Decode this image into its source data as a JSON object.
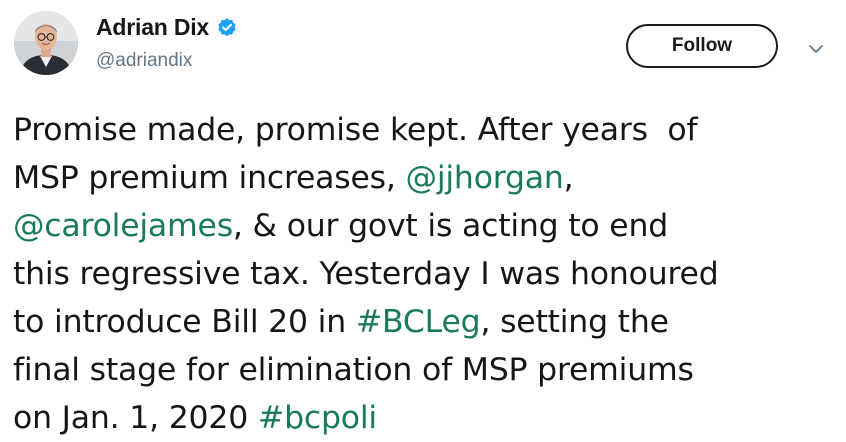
{
  "author": {
    "display_name": "Adrian Dix",
    "handle": "@adriandix",
    "verified_icon": "verified-badge-icon",
    "verified_color": "#1da1f2"
  },
  "actions": {
    "follow_label": "Follow",
    "more_icon": "chevron-down-icon"
  },
  "tweet": {
    "line1": "Promise made, promise kept. After years  of",
    "line2_text": "MSP premium increases, ",
    "line2_mention": "@jjhorgan",
    "line2_tail": ",",
    "line3_mention": "@carolejames",
    "line3_text": ", & our govt is acting to end",
    "line4": "this regressive tax. Yesterday I was honoured",
    "line5_text": "to introduce Bill 20 in ",
    "line5_hashtag": "#BCLeg",
    "line5_tail": ", setting the",
    "line6": "final stage for elimination of MSP premiums",
    "line7_text": "on Jan. 1, 2020 ",
    "line7_hashtag": "#bcpoli",
    "link_color": "#1b7a5a"
  }
}
